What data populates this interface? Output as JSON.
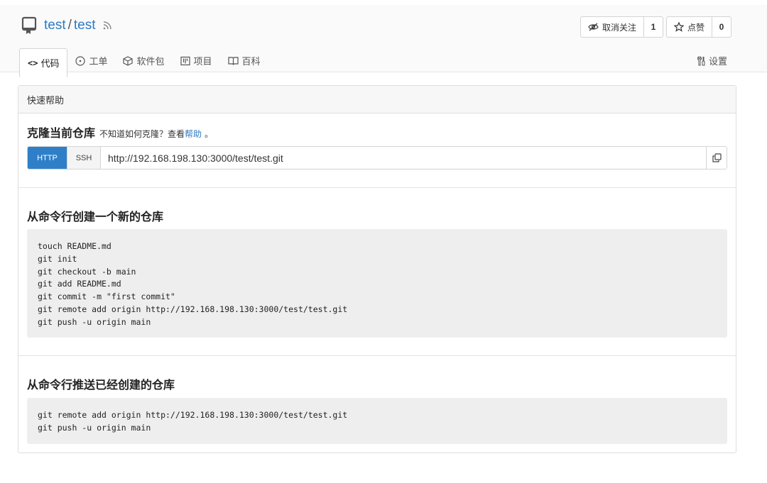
{
  "header": {
    "owner": "test",
    "separator": "/",
    "repo": "test",
    "actions": {
      "unwatch_label": "取消关注",
      "watch_count": "1",
      "star_label": "点赞",
      "star_count": "0"
    },
    "tabs": [
      {
        "icon": "code-icon",
        "label": "代码",
        "active": true
      },
      {
        "icon": "issue-icon",
        "label": "工单"
      },
      {
        "icon": "package-icon",
        "label": "软件包"
      },
      {
        "icon": "project-icon",
        "label": "项目"
      },
      {
        "icon": "book-icon",
        "label": "百科"
      }
    ],
    "settings_label": "设置"
  },
  "panel": {
    "title": "快速帮助",
    "clone": {
      "heading": "克隆当前仓库",
      "hint": "不知道如何克隆？查看",
      "help_link": "帮助",
      "hint_end": "。",
      "http_label": "HTTP",
      "ssh_label": "SSH",
      "url": "http://192.168.198.130:3000/test/test.git"
    },
    "new_repo": {
      "heading": "从命令行创建一个新的仓库",
      "code": "touch README.md\ngit init\ngit checkout -b main\ngit add README.md\ngit commit -m \"first commit\"\ngit remote add origin http://192.168.198.130:3000/test/test.git\ngit push -u origin main"
    },
    "push_existing": {
      "heading": "从命令行推送已经创建的仓库",
      "code": "git remote add origin http://192.168.198.130:3000/test/test.git\ngit push -u origin main"
    }
  },
  "colors": {
    "accent": "#2c7bc5",
    "http_button": "#2f7fc8",
    "code_bg": "#eeeeee"
  }
}
